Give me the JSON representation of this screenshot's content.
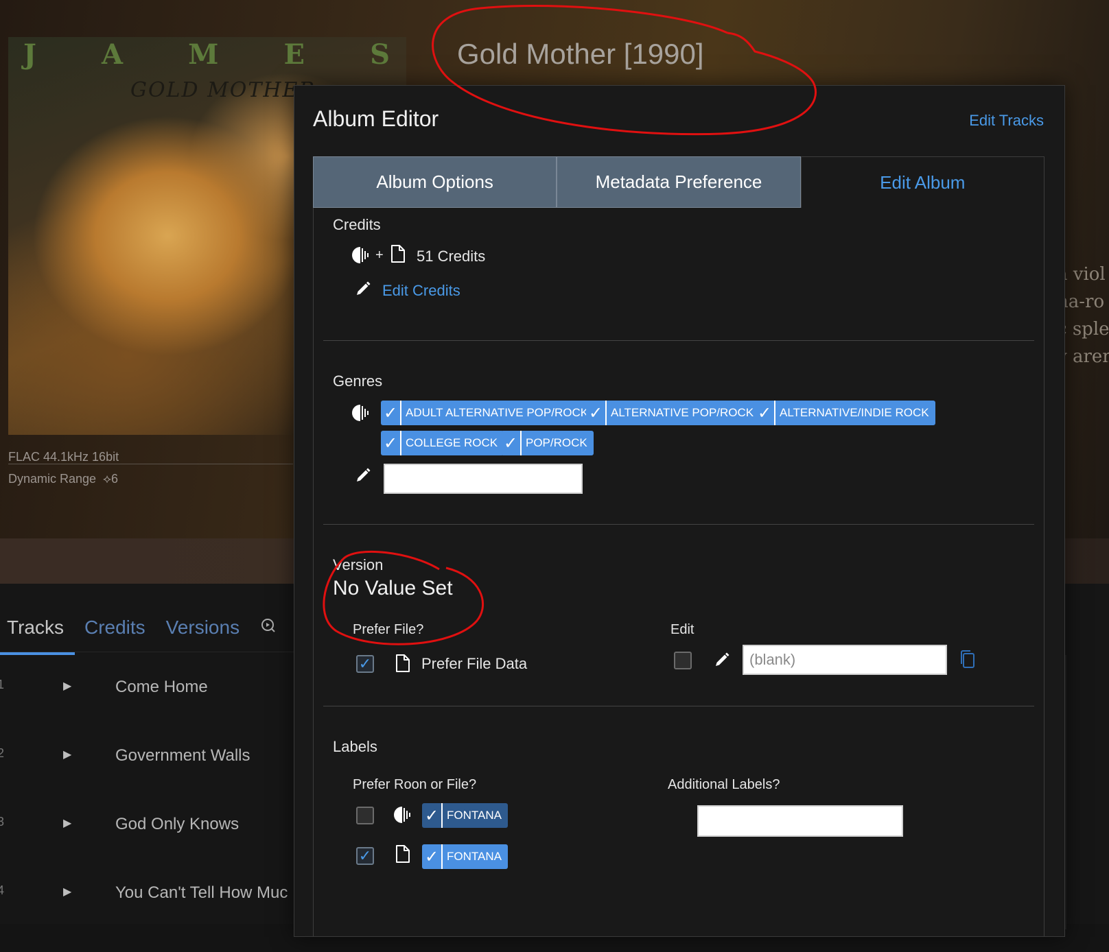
{
  "background": {
    "album_heading": "Gold Mother [1990]",
    "cover": {
      "letters": [
        "J",
        "A",
        "M",
        "E",
        "S"
      ],
      "title": "GOLD MOTHER"
    },
    "format": "FLAC 44.1kHz 16bit",
    "dynamic_range_label": "Dynamic Range",
    "dynamic_range_value": "6",
    "bio_lines": [
      "a viol",
      "na-ro",
      "c sple",
      "y aren"
    ],
    "nav_tabs": [
      {
        "label": "Tracks",
        "active": true
      },
      {
        "label": "Credits",
        "active": false
      },
      {
        "label": "Versions",
        "active": false
      }
    ],
    "tracks": [
      {
        "num": "1",
        "name": "Come Home"
      },
      {
        "num": "2",
        "name": "Government Walls"
      },
      {
        "num": "3",
        "name": "God Only Knows"
      },
      {
        "num": "4",
        "name": "You Can't Tell How Muc"
      }
    ]
  },
  "dialog": {
    "title": "Album Editor",
    "edit_tracks_link": "Edit Tracks",
    "tabs": [
      {
        "label": "Album Options",
        "active": false
      },
      {
        "label": "Metadata Preference",
        "active": false
      },
      {
        "label": "Edit Album",
        "active": true
      }
    ],
    "credits": {
      "heading": "Credits",
      "count_text": "51 Credits",
      "edit_link": "Edit Credits"
    },
    "genres": {
      "heading": "Genres",
      "chips": [
        "ADULT ALTERNATIVE POP/ROCK",
        "ALTERNATIVE POP/ROCK",
        "ALTERNATIVE/INDIE ROCK",
        "COLLEGE ROCK",
        "POP/ROCK"
      ],
      "new_genre_value": ""
    },
    "version": {
      "heading": "Version",
      "value": "No Value Set",
      "prefer_file_label": "Prefer File?",
      "prefer_file_checked": true,
      "prefer_file_data": "Prefer File Data",
      "edit_label": "Edit",
      "edit_checked": false,
      "edit_placeholder": "(blank)"
    },
    "labels": {
      "heading": "Labels",
      "prefer_label": "Prefer Roon or File?",
      "additional_label": "Additional Labels?",
      "roon_checked": false,
      "file_checked": true,
      "roon_label": "FONTANA",
      "file_label": "FONTANA",
      "additional_value": ""
    }
  },
  "colors": {
    "accent": "#4a9ae8",
    "chip": "#4a90e2",
    "annotation": "#e01010"
  }
}
